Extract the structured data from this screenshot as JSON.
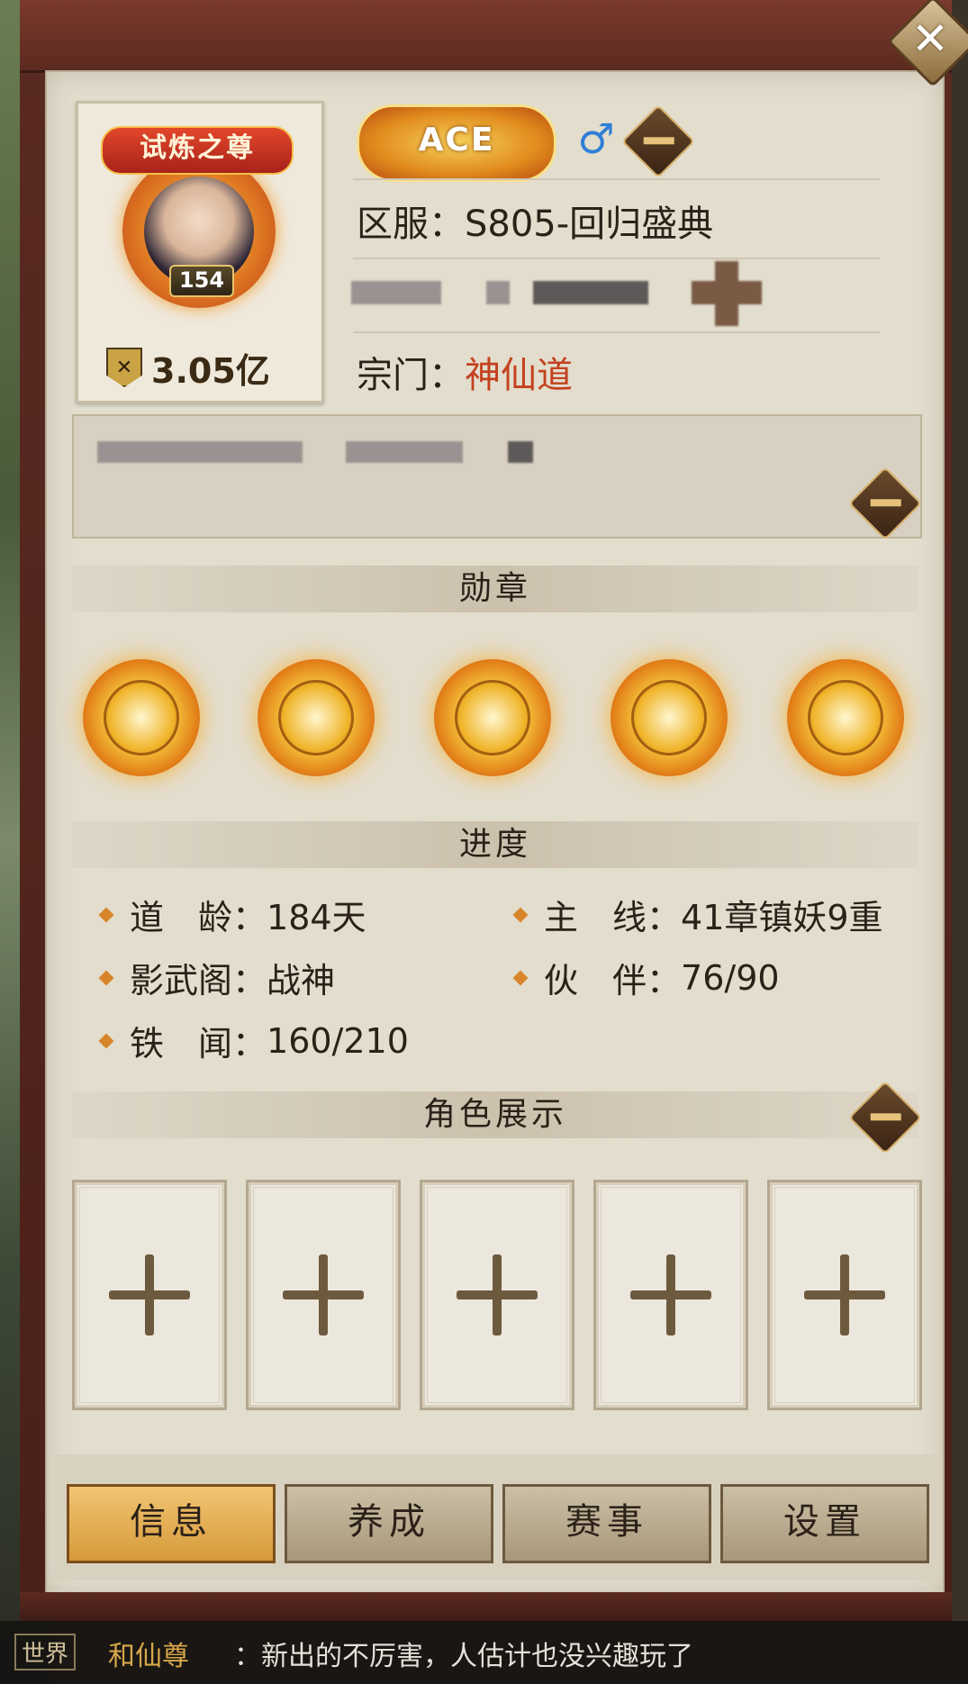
{
  "header": {
    "close_label": "✕"
  },
  "profile": {
    "title_banner": "试炼之尊",
    "level": "154",
    "power": "3.05亿",
    "ace_label": "ACE",
    "gender_symbol": "♂",
    "server": "区服：S805-回归盛典",
    "sect_label": "宗门：",
    "sect_value": "神仙道"
  },
  "sections": {
    "medals_title": "勋章",
    "progress_title": "进度",
    "showcase_title": "角色展示"
  },
  "stats": [
    {
      "label": "道　龄",
      "value": "184天"
    },
    {
      "label": "主　线",
      "value": "41章镇妖9重"
    },
    {
      "label": "影武阁",
      "value": "战神"
    },
    {
      "label": "伙　伴",
      "value": "76/90"
    },
    {
      "label": "铁　闻",
      "value": "160/210"
    }
  ],
  "tabs": [
    {
      "label": "信息",
      "active": true
    },
    {
      "label": "养成",
      "active": false
    },
    {
      "label": "赛事",
      "active": false
    },
    {
      "label": "设置",
      "active": false
    }
  ],
  "chat": {
    "channel": "世界",
    "name": "和仙尊",
    "message": "：新出的不厉害，人估计也没兴趣玩了"
  },
  "colors": {
    "accent": "#d69a3a",
    "sect": "#c3411f",
    "male": "#2f7fd6"
  }
}
